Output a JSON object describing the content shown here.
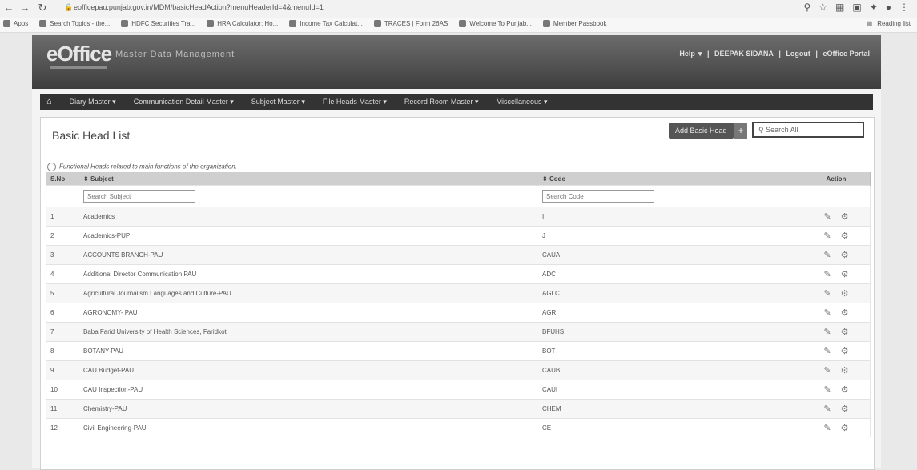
{
  "browser": {
    "url": "eofficepau.punjab.gov.in/MDM/basicHeadAction?menuHeaderId=4&menuId=1",
    "bookmarks": [
      "Apps",
      "Search Topics - the...",
      "HDFC Securities Tra...",
      "HRA Calculator: Ho...",
      "Income Tax Calculat...",
      "TRACES | Form 26AS",
      "Welcome To Punjab...",
      "Member Passbook"
    ],
    "reading_list": "Reading list"
  },
  "header": {
    "logo": "eOffice",
    "app_name": "Master Data Management",
    "help": "Help",
    "user": "DEEPAK SIDANA",
    "logout": "Logout",
    "portal": "eOffice Portal"
  },
  "menu": [
    "Diary Master",
    "Communication Detail Master",
    "Subject Master",
    "File Heads Master",
    "Record Room Master",
    "Miscellaneous"
  ],
  "page": {
    "title": "Basic Head  List",
    "add_button": "Add Basic Head",
    "plus": "+",
    "search_all": "Search All",
    "info": "Functional Heads related to main functions of the organization."
  },
  "table": {
    "headers": [
      "S.No",
      "Subject",
      "Code",
      "Action"
    ],
    "search_subject": "Search Subject",
    "search_code": "Search Code",
    "rows": [
      {
        "sno": "1",
        "subject": "Academics",
        "code": "I"
      },
      {
        "sno": "2",
        "subject": "Academics-PUP",
        "code": "J"
      },
      {
        "sno": "3",
        "subject": "ACCOUNTS BRANCH-PAU",
        "code": "CAUA"
      },
      {
        "sno": "4",
        "subject": "Additional Director Communication PAU",
        "code": "ADC"
      },
      {
        "sno": "5",
        "subject": "Agricultural Journalism Languages and Culture-PAU",
        "code": "AGLC"
      },
      {
        "sno": "6",
        "subject": "AGRONOMY- PAU",
        "code": "AGR"
      },
      {
        "sno": "7",
        "subject": "Baba Farid University of Health Sciences, Faridkot",
        "code": "BFUHS"
      },
      {
        "sno": "8",
        "subject": "BOTANY-PAU",
        "code": "BOT"
      },
      {
        "sno": "9",
        "subject": "CAU Budget-PAU",
        "code": "CAUB"
      },
      {
        "sno": "10",
        "subject": "CAU Inspection-PAU",
        "code": "CAUI"
      },
      {
        "sno": "11",
        "subject": "Chemistry-PAU",
        "code": "CHEM"
      },
      {
        "sno": "12",
        "subject": "Civil Engineering-PAU",
        "code": "CE"
      }
    ]
  }
}
